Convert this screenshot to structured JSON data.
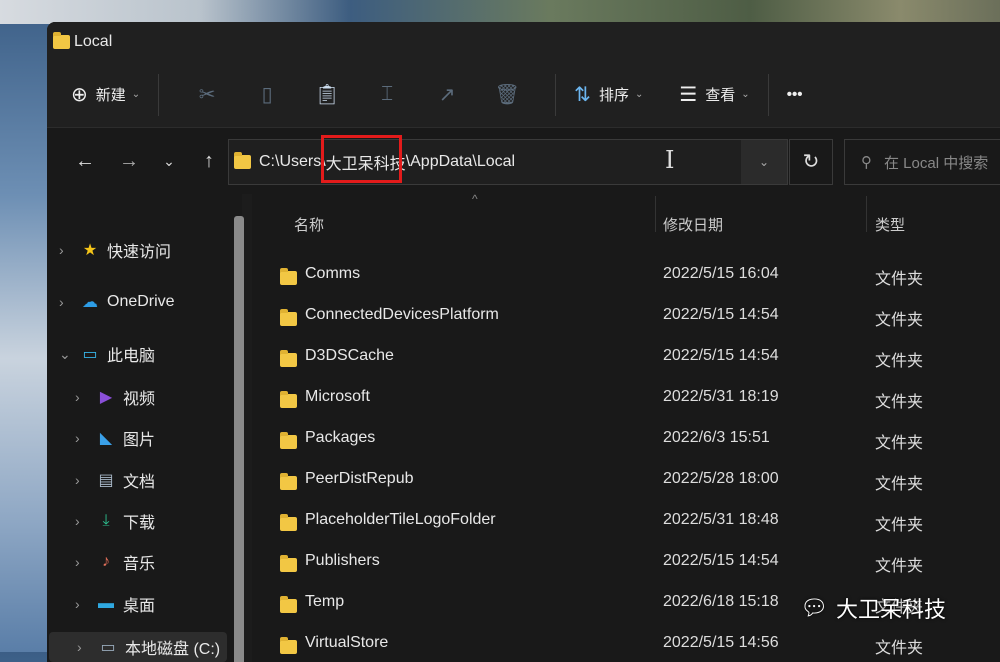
{
  "window": {
    "title": "Local"
  },
  "toolbar": {
    "new": "新建",
    "sort": "排序",
    "view": "查看",
    "more": "•••"
  },
  "address": {
    "prefix": "C:\\Users\\",
    "user": "大卫呆科技",
    "suffix": "\\AppData\\Local"
  },
  "search": {
    "placeholder": "在 Local 中搜索"
  },
  "sidebar": [
    {
      "label": "快速访问",
      "icon": "star-icon",
      "color": "#f5c518"
    },
    {
      "label": "OneDrive",
      "icon": "cloud-icon",
      "color": "#2d9de6"
    },
    {
      "label": "此电脑",
      "icon": "computer-icon",
      "color": "#37b5e8"
    },
    {
      "label": "视频",
      "icon": "video-icon",
      "color": "#8a4fd8"
    },
    {
      "label": "图片",
      "icon": "picture-icon",
      "color": "#3aa0e8"
    },
    {
      "label": "文档",
      "icon": "document-icon",
      "color": "#a8b8c8"
    },
    {
      "label": "下载",
      "icon": "download-icon",
      "color": "#2dbf8f"
    },
    {
      "label": "音乐",
      "icon": "music-icon",
      "color": "#e2705a"
    },
    {
      "label": "桌面",
      "icon": "desktop-icon",
      "color": "#2fa8e0"
    },
    {
      "label": "本地磁盘 (C:)",
      "icon": "drive-icon",
      "color": "#9ab"
    }
  ],
  "columns": {
    "name": "名称",
    "date": "修改日期",
    "type": "类型"
  },
  "files": [
    {
      "name": "Comms",
      "date": "2022/5/15 16:04",
      "type": "文件夹"
    },
    {
      "name": "ConnectedDevicesPlatform",
      "date": "2022/5/15 14:54",
      "type": "文件夹"
    },
    {
      "name": "D3DSCache",
      "date": "2022/5/15 14:54",
      "type": "文件夹"
    },
    {
      "name": "Microsoft",
      "date": "2022/5/31 18:19",
      "type": "文件夹"
    },
    {
      "name": "Packages",
      "date": "2022/6/3 15:51",
      "type": "文件夹"
    },
    {
      "name": "PeerDistRepub",
      "date": "2022/5/28 18:00",
      "type": "文件夹"
    },
    {
      "name": "PlaceholderTileLogoFolder",
      "date": "2022/5/31 18:48",
      "type": "文件夹"
    },
    {
      "name": "Publishers",
      "date": "2022/5/15 14:54",
      "type": "文件夹"
    },
    {
      "name": "Temp",
      "date": "2022/6/18 15:18",
      "type": "文件夹"
    },
    {
      "name": "VirtualStore",
      "date": "2022/5/15 14:56",
      "type": "文件夹"
    }
  ],
  "watermark": "大卫呆科技"
}
